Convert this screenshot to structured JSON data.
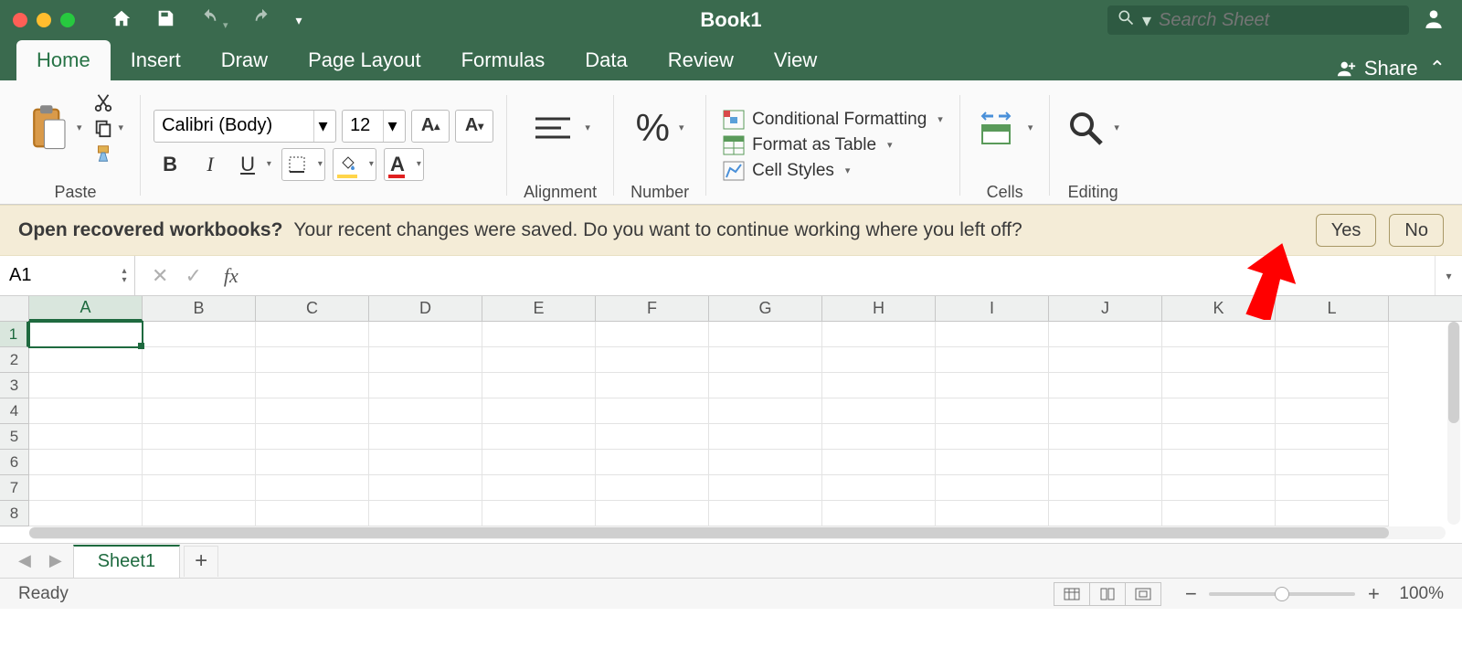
{
  "titlebar": {
    "doc_title": "Book1",
    "search_placeholder": "Search Sheet"
  },
  "tabs": {
    "items": [
      "Home",
      "Insert",
      "Draw",
      "Page Layout",
      "Formulas",
      "Data",
      "Review",
      "View"
    ],
    "active_index": 0,
    "share_label": "Share"
  },
  "ribbon": {
    "paste_label": "Paste",
    "font_name": "Calibri (Body)",
    "font_size": "12",
    "alignment_label": "Alignment",
    "number_label": "Number",
    "cond_fmt_label": "Conditional Formatting",
    "fmt_table_label": "Format as Table",
    "cell_styles_label": "Cell Styles",
    "cells_label": "Cells",
    "editing_label": "Editing"
  },
  "recovery": {
    "question": "Open recovered workbooks?",
    "message": "Your recent changes were saved. Do you want to continue working where you left off?",
    "yes": "Yes",
    "no": "No"
  },
  "formula_bar": {
    "cell_ref": "A1",
    "formula": ""
  },
  "grid": {
    "columns": [
      "A",
      "B",
      "C",
      "D",
      "E",
      "F",
      "G",
      "H",
      "I",
      "J",
      "K",
      "L"
    ],
    "rows": [
      "1",
      "2",
      "3",
      "4",
      "5",
      "6",
      "7",
      "8"
    ],
    "active_cell": "A1"
  },
  "sheets": {
    "active": "Sheet1"
  },
  "status": {
    "ready": "Ready",
    "zoom": "100%"
  }
}
